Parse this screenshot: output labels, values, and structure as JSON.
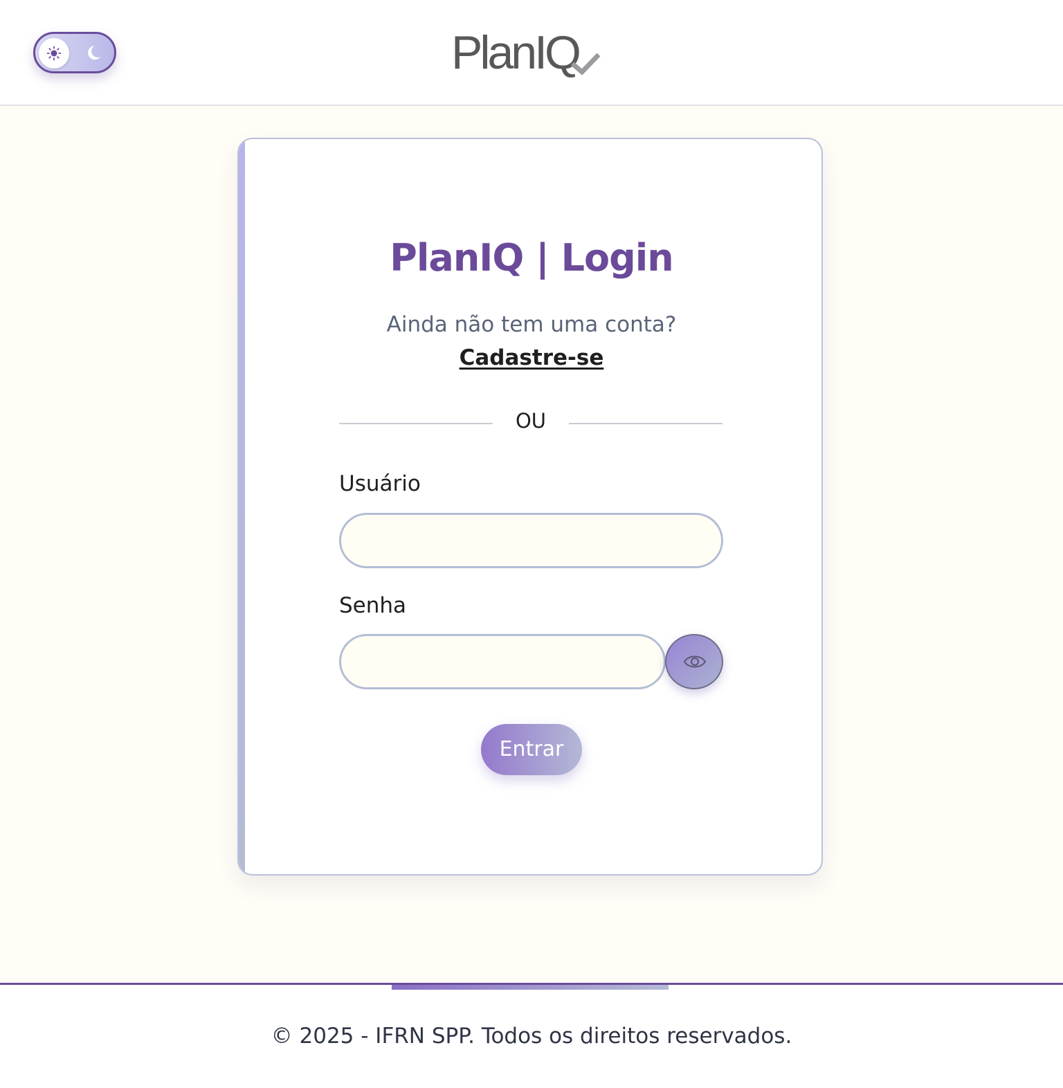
{
  "header": {
    "brand": "PlanIQ",
    "theme_toggle": {
      "light_icon": "sun-icon",
      "dark_icon": "moon-icon",
      "selected": "light"
    }
  },
  "login": {
    "title": "PlanIQ | Login",
    "signup_prompt": "Ainda não tem uma conta?",
    "signup_link": "Cadastre-se",
    "divider": "OU",
    "username_label": "Usuário",
    "username_value": "",
    "password_label": "Senha",
    "password_value": "",
    "password_toggle_icon": "eye-icon",
    "submit_label": "Entrar"
  },
  "footer": {
    "copyright": "© 2025 - IFRN SPP. Todos os direitos reservados."
  },
  "colors": {
    "primary": "#6b4a9a",
    "background": "#fffdf6",
    "input_border": "#b3bdd4",
    "button_gradient_start": "#9479cc",
    "button_gradient_end": "#b3b8d6"
  }
}
